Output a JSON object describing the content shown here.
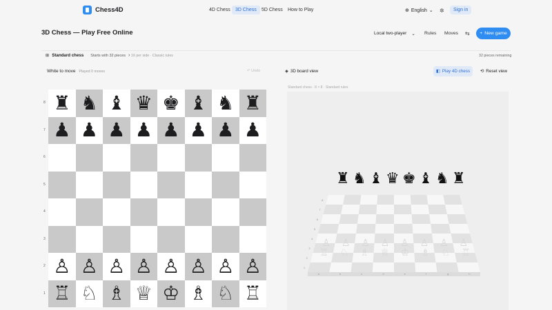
{
  "brand": {
    "name": "Chess4D"
  },
  "nav": [
    {
      "label": "4D Chess",
      "active": false
    },
    {
      "label": "3D Chess",
      "active": true
    },
    {
      "label": "5D Chess",
      "active": false
    },
    {
      "label": "How to Play",
      "active": false
    }
  ],
  "header": {
    "language": "English",
    "sign_in": "Sign in"
  },
  "page": {
    "title": "3D Chess — Play Free Online"
  },
  "toolbar": {
    "mode": "Local two-player",
    "rules": "Rules",
    "moves": "Moves",
    "new_game": "New game"
  },
  "variant": {
    "name": "Standard chess",
    "subtitle": "Starts with 32 pieces",
    "info": "16 per side · Classic rules",
    "remaining": "32 pieces remaining"
  },
  "game": {
    "status": "White to move",
    "played": "Played 0 moves",
    "undo": "Undo"
  },
  "view3d": {
    "label": "3D board view",
    "play4d": "Play 4D chess",
    "reset": "Reset view",
    "caption": "Standard chess · 8 × 8 · Standard rules"
  },
  "board": {
    "ranks": [
      "8",
      "7",
      "6",
      "5",
      "4",
      "3",
      "2",
      "1"
    ],
    "rows": [
      [
        "♜",
        "♞",
        "♝",
        "♛",
        "♚",
        "♝",
        "♞",
        "♜"
      ],
      [
        "♟",
        "♟",
        "♟",
        "♟",
        "♟",
        "♟",
        "♟",
        "♟"
      ],
      [
        "",
        "",
        "",
        "",
        "",
        "",
        "",
        ""
      ],
      [
        "",
        "",
        "",
        "",
        "",
        "",
        "",
        ""
      ],
      [
        "",
        "",
        "",
        "",
        "",
        "",
        "",
        ""
      ],
      [
        "",
        "",
        "",
        "",
        "",
        "",
        "",
        ""
      ],
      [
        "♙",
        "♙",
        "♙",
        "♙",
        "♙",
        "♙",
        "♙",
        "♙"
      ],
      [
        "♖",
        "♘",
        "♗",
        "♕",
        "♔",
        "♗",
        "♘",
        "♖"
      ]
    ],
    "files": [
      "a",
      "b",
      "c",
      "d",
      "e",
      "f",
      "g",
      "h"
    ]
  },
  "colors": {
    "accent": "#2f8cf0",
    "light_square": "#ffffff",
    "dark_square": "#c9c9c9"
  }
}
